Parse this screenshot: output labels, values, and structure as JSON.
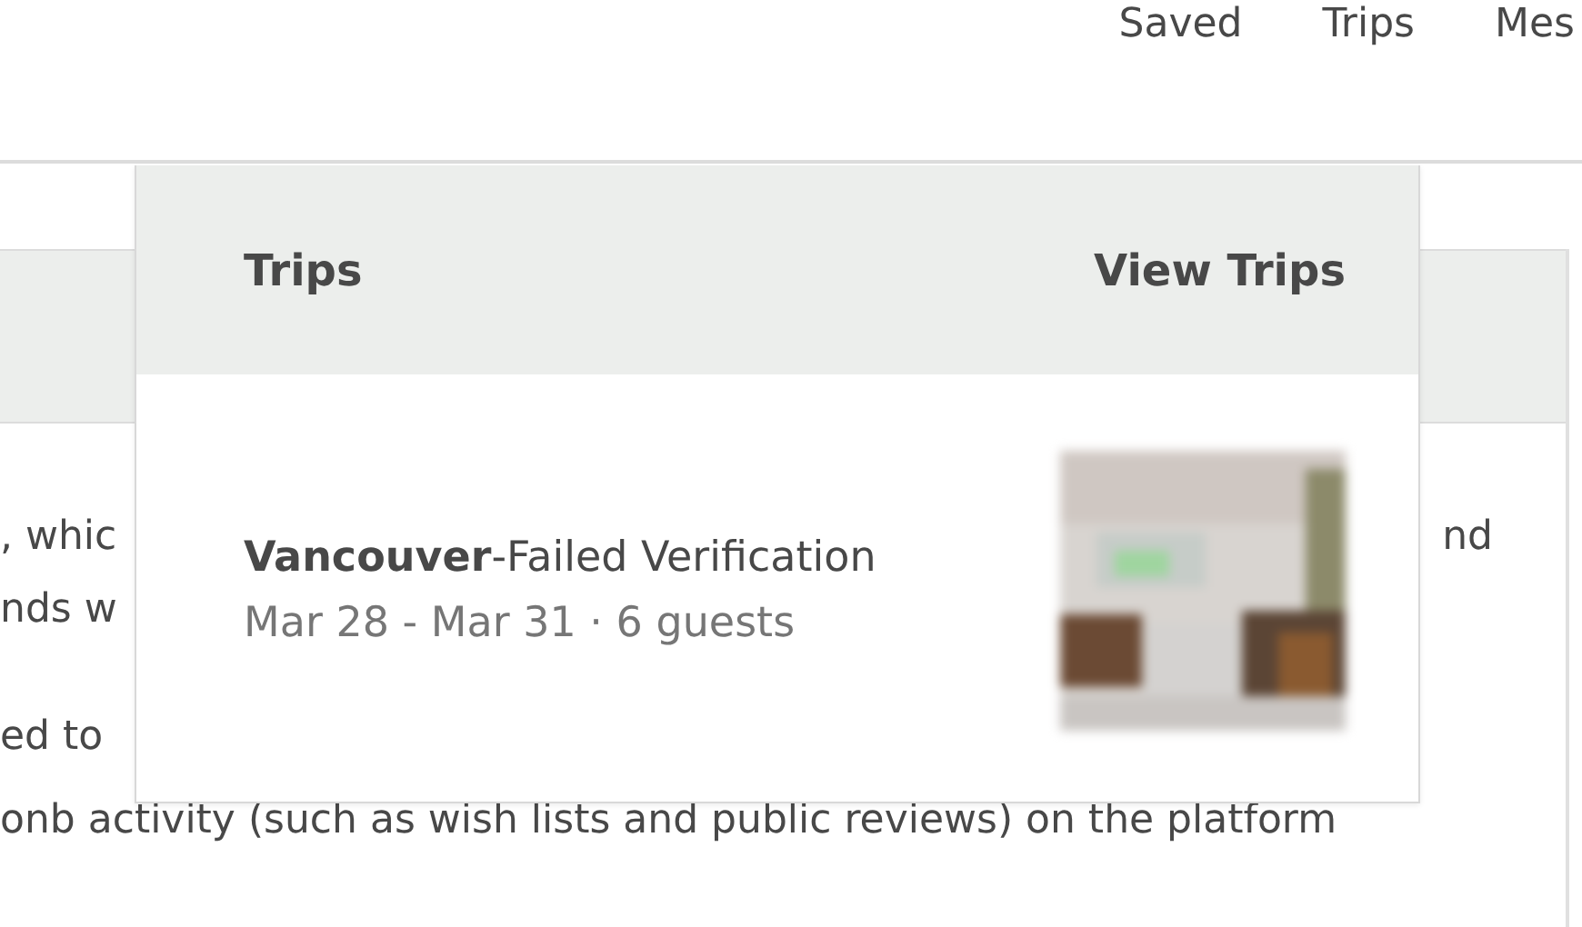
{
  "nav": [
    "Saved",
    "Trips",
    "Mes"
  ],
  "page_text": [
    {
      "left": ", whic",
      "right": "nd"
    },
    {
      "left": "nds w"
    },
    {
      "left": "ed to"
    },
    {
      "left": "onb activity (such as wish lists and public reviews) on the platform"
    }
  ],
  "trips_menu": {
    "title": "Trips",
    "link": "View Trips",
    "trips": [
      {
        "title": "**Vancouver**-Failed Verification",
        "details": "Mar 28 - Mar 31 · 6 guests"
      }
    ]
  }
}
